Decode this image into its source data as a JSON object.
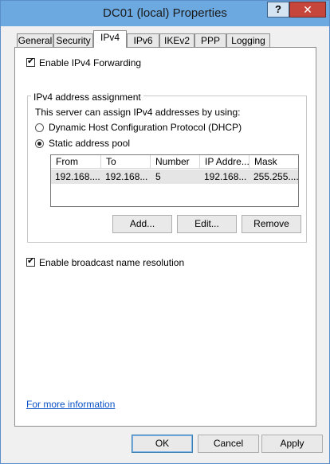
{
  "window": {
    "title": "DC01 (local) Properties",
    "help_label": "?",
    "close_label": "✕"
  },
  "tabs": [
    {
      "label": "General",
      "active": false
    },
    {
      "label": "Security",
      "active": false
    },
    {
      "label": "IPv4",
      "active": true
    },
    {
      "label": "IPv6",
      "active": false
    },
    {
      "label": "IKEv2",
      "active": false
    },
    {
      "label": "PPP",
      "active": false
    },
    {
      "label": "Logging",
      "active": false
    }
  ],
  "ipv4": {
    "forwarding_label": "Enable IPv4 Forwarding",
    "forwarding_checked": true,
    "assignment_group_title": "IPv4 address assignment",
    "assignment_intro": "This server can assign IPv4 addresses by using:",
    "options": [
      {
        "label": "Dynamic Host Configuration Protocol (DHCP)",
        "selected": false
      },
      {
        "label": "Static address pool",
        "selected": true
      }
    ],
    "pool_table": {
      "columns": [
        "From",
        "To",
        "Number",
        "IP Addre...",
        "Mask"
      ],
      "rows": [
        [
          "192.168....",
          "192.168...",
          "5",
          "192.168...",
          "255.255...."
        ]
      ]
    },
    "buttons": {
      "add": "Add...",
      "edit": "Edit...",
      "remove": "Remove"
    },
    "broadcast_label": "Enable broadcast name resolution",
    "broadcast_checked": true
  },
  "footer": {
    "more_info_link": "For more information",
    "ok": "OK",
    "cancel": "Cancel",
    "apply": "Apply"
  },
  "icons": {
    "checkmark": "check-icon",
    "radio": "radio-dot-icon"
  }
}
